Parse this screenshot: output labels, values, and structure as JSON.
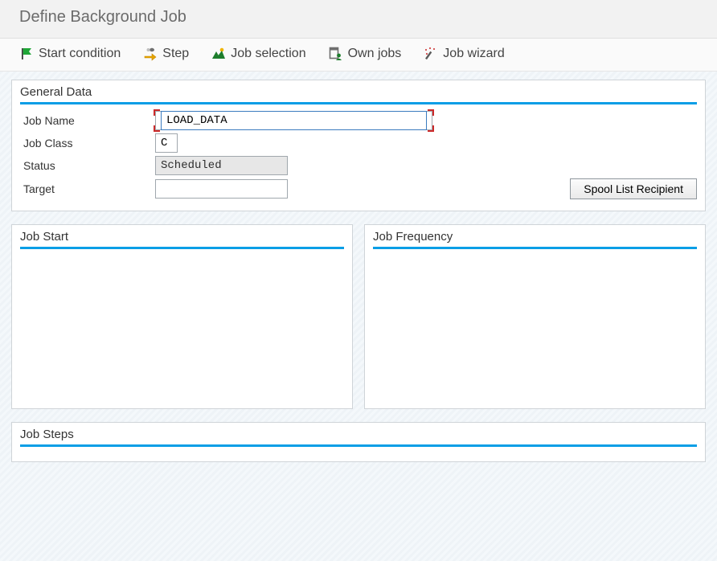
{
  "title": "Define Background Job",
  "toolbar": {
    "start_condition": "Start condition",
    "step": "Step",
    "job_selection": "Job selection",
    "own_jobs": "Own jobs",
    "job_wizard": "Job wizard"
  },
  "panels": {
    "general_data": {
      "title": "General Data",
      "fields": {
        "job_name": {
          "label": "Job Name",
          "value": "LOAD_DATA"
        },
        "job_class": {
          "label": "Job Class",
          "value": "C"
        },
        "status": {
          "label": "Status",
          "value": "Scheduled"
        },
        "target": {
          "label": "Target",
          "value": ""
        }
      },
      "buttons": {
        "spool_list_recipient": "Spool List Recipient"
      }
    },
    "job_start": {
      "title": "Job Start"
    },
    "job_frequency": {
      "title": "Job Frequency"
    },
    "job_steps": {
      "title": "Job Steps"
    }
  }
}
